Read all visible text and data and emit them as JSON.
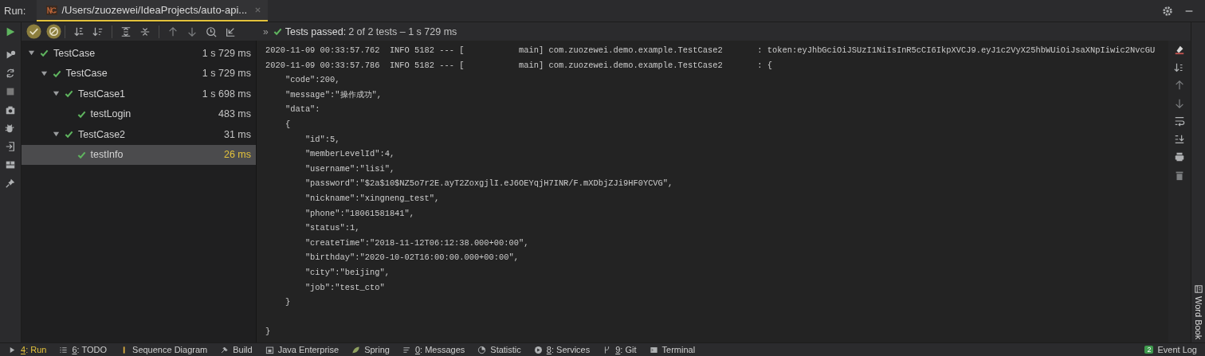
{
  "run_panel": {
    "label": "Run:",
    "tabs": [
      {
        "title": "/Users/zuozewei/IdeaProjects/auto-api...",
        "selected": true
      }
    ]
  },
  "toolbar": {
    "toggles": [
      {
        "on": true
      },
      {
        "on": true
      }
    ],
    "overflow": "»"
  },
  "status": {
    "passed": true,
    "label": "Tests passed:",
    "detail": "2 of 2 tests – 1 s 729 ms"
  },
  "tree": {
    "items": [
      {
        "name": "TestCase",
        "time": "1 s 729 ms",
        "passed": true,
        "selected": false,
        "expanded": true,
        "children": [
          {
            "name": "TestCase",
            "time": "1 s 729 ms",
            "passed": true,
            "selected": false,
            "expanded": true,
            "children": [
              {
                "name": "TestCase1",
                "time": "1 s 698 ms",
                "passed": true,
                "selected": false,
                "expanded": true,
                "children": [
                  {
                    "name": "testLogin",
                    "time": "483 ms",
                    "passed": true,
                    "selected": false
                  }
                ]
              },
              {
                "name": "TestCase2",
                "time": "31 ms",
                "passed": true,
                "selected": false,
                "expanded": true,
                "children": [
                  {
                    "name": "testInfo",
                    "time": "26 ms",
                    "passed": true,
                    "selected": true
                  }
                ]
              }
            ]
          }
        ]
      }
    ]
  },
  "console": {
    "lines": [
      "2020-11-09 00:33:57.762  INFO 5182 --- [           main] com.zuozewei.demo.example.TestCase2       : token:eyJhbGciOiJSUzI1NiIsInR5cCI6IkpXVCJ9.eyJ1c2VyX25hbWUiOiJsaXNpIiwic2NvcGU",
      "2020-11-09 00:33:57.786  INFO 5182 --- [           main] com.zuozewei.demo.example.TestCase2       : {",
      "    \"code\":200,",
      "    \"message\":\"操作成功\",",
      "    \"data\":",
      "    {",
      "        \"id\":5,",
      "        \"memberLevelId\":4,",
      "        \"username\":\"lisi\",",
      "        \"password\":\"$2a$10$NZ5o7r2E.ayT2ZoxgjlI.eJ6OEYqjH7INR/F.mXDbjZJi9HF0YCVG\",",
      "        \"nickname\":\"xingneng_test\",",
      "        \"phone\":\"18061581841\",",
      "        \"status\":1,",
      "        \"createTime\":\"2018-11-12T06:12:38.000+00:00\",",
      "        \"birthday\":\"2020-10-02T16:00:00.000+00:00\",",
      "        \"city\":\"beijing\",",
      "        \"job\":\"test_cto\"",
      "    }",
      "}"
    ]
  },
  "side_panel": {
    "label": "Word Book"
  },
  "bottom_bar": {
    "items": [
      {
        "mnemonic": "4",
        "label": ": Run",
        "selected": true
      },
      {
        "mnemonic": "6",
        "label": ": TODO",
        "selected": false
      },
      {
        "label": "Sequence Diagram",
        "selected": false
      },
      {
        "label": "Build",
        "selected": false
      },
      {
        "label": "Java Enterprise",
        "selected": false
      },
      {
        "label": "Spring",
        "selected": false
      },
      {
        "mnemonic": "0",
        "label": ": Messages",
        "selected": false
      },
      {
        "label": "Statistic",
        "selected": false
      },
      {
        "mnemonic": "8",
        "label": ": Services",
        "selected": false
      },
      {
        "mnemonic": "9",
        "label": ": Git",
        "selected": false
      },
      {
        "label": "Terminal",
        "selected": false
      }
    ],
    "event_log": {
      "badge": "2",
      "label": "Event Log"
    }
  }
}
